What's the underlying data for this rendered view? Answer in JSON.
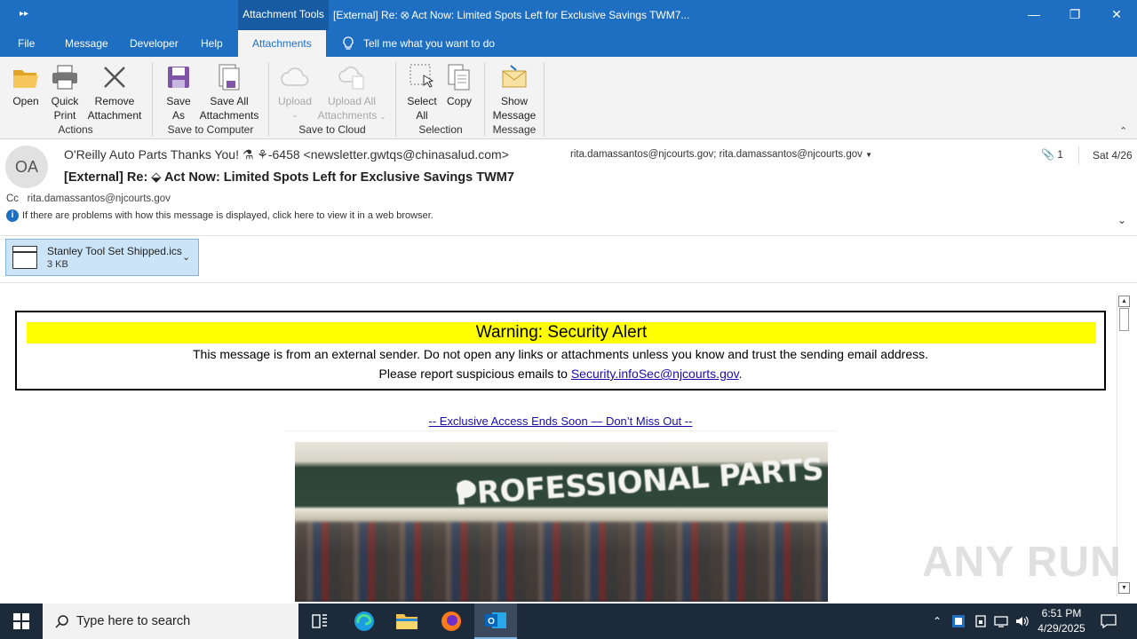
{
  "titlebar": {
    "tools_label": "Attachment Tools",
    "title": "[External] Re: ⭙ Act Now: Limited Spots Left for Exclusive Savings     TWM7..."
  },
  "tabs": [
    {
      "label": "File"
    },
    {
      "label": "Message"
    },
    {
      "label": "Developer"
    },
    {
      "label": "Help"
    },
    {
      "label": "Attachments"
    }
  ],
  "tell_me": "Tell me what you want to do",
  "ribbon": {
    "open": "Open",
    "quick_print_1": "Quick",
    "quick_print_2": "Print",
    "remove_1": "Remove",
    "remove_2": "Attachment",
    "save_as_1": "Save",
    "save_as_2": "As",
    "save_all_1": "Save All",
    "save_all_2": "Attachments",
    "upload": "Upload",
    "upload_all_1": "Upload All",
    "upload_all_2": "Attachments",
    "select_all_1": "Select",
    "select_all_2": "All",
    "copy": "Copy",
    "show_msg_1": "Show",
    "show_msg_2": "Message",
    "groups": {
      "actions": "Actions",
      "save_computer": "Save to Computer",
      "save_cloud": "Save to Cloud",
      "selection": "Selection",
      "message": "Message"
    }
  },
  "header": {
    "avatar": "OA",
    "from": "O'Reilly Auto Parts Thanks You! ⚗ ⚘-6458 <newsletter.gwtqs@chinasalud.com>",
    "to": "rita.damassantos@njcourts.gov; rita.damassantos@njcourts.gov",
    "attach_count": "1",
    "date": "Sat 4/26",
    "subject": "[External] Re: ⬙ Act Now: Limited Spots Left for Exclusive Savings     TWM7",
    "cc_label": "Cc",
    "cc": "rita.damassantos@njcourts.gov",
    "info": "If there are problems with how this message is displayed, click here to view it in a web browser."
  },
  "attachment": {
    "name": "Stanley Tool Set Shipped.ics",
    "size": "3 KB"
  },
  "body": {
    "warning_title": "Warning: Security Alert",
    "warning_line1": "This message is from an external sender. Do not open any links or attachments unless you know and trust the sending email address.",
    "warning_line2_prefix": "Please report suspicious emails to ",
    "warning_link": "Security.infoSec@njcourts.gov",
    "warning_line2_suffix": ".",
    "promo_link": "-- Exclusive Access Ends Soon — Don’t Miss Out --",
    "image_sign": "PROFESSIONAL PARTS PEOPLE"
  },
  "watermark": "ANY RUN",
  "taskbar": {
    "search_placeholder": "Type here to search",
    "time": "6:51 PM",
    "date": "4/29/2025"
  },
  "colors": {
    "accent": "#1e6fc1",
    "warning_bar": "#ffff00",
    "attachment_bg": "#cce4f7"
  }
}
